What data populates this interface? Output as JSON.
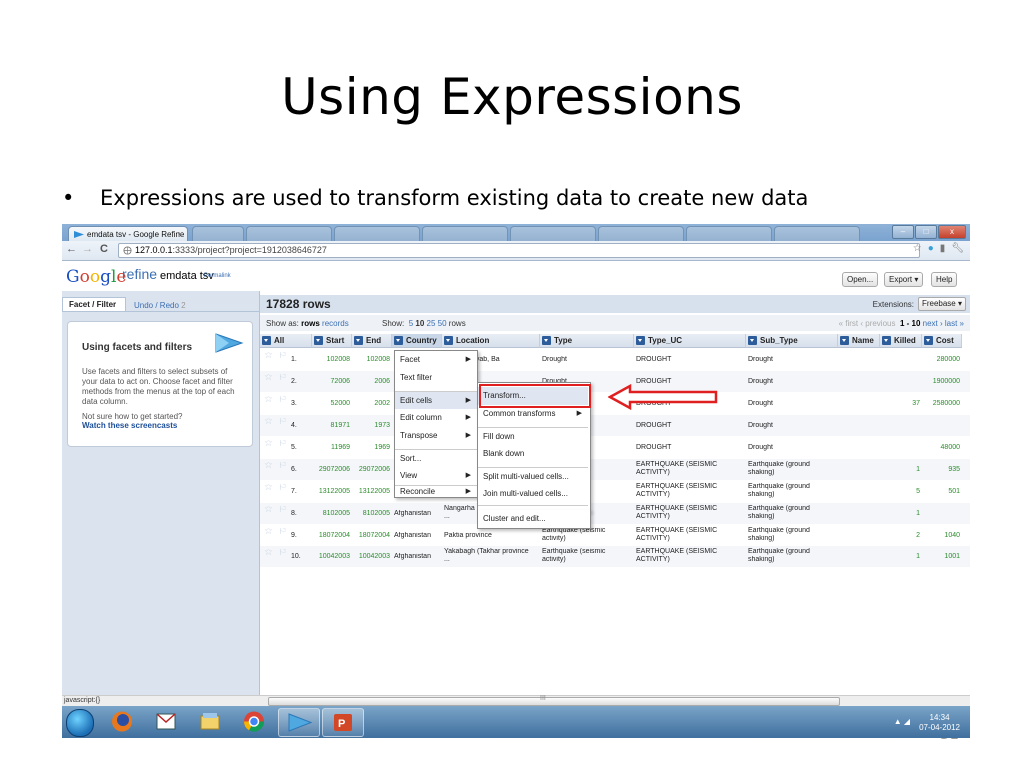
{
  "slide": {
    "title": "Using Expressions",
    "bullet_marker": "•",
    "bullet": "Expressions are used to transform existing data to create new data",
    "slide_number": "31"
  },
  "browser": {
    "tab_title": "emdata tsv - Google Refine",
    "tab_close": "×",
    "url_host": "127.0.0.1",
    "url_rest": ":3333/project?project=1912038646727",
    "nav_back": "←",
    "nav_forward": "→",
    "nav_reload": "C"
  },
  "app": {
    "logo_letters": [
      "G",
      "o",
      "o",
      "g",
      "l",
      "e"
    ],
    "product": "refine",
    "project_name": "emdata tsv",
    "permalink": "Permalink",
    "buttons": [
      "Open...",
      "Export ▾",
      "Help"
    ]
  },
  "left_panel": {
    "tab_active": "Facet / Filter",
    "tab_other": "Undo / Redo",
    "tab_other_count": "2",
    "help_title": "Using facets and filters",
    "help_text": "Use facets and filters to select subsets of your data to act on. Choose facet and filter methods from the menus at the top of each data column.",
    "help_question": "Not sure how to get started?",
    "help_link": "Watch these screencasts"
  },
  "data_panel": {
    "row_count": "17828 rows",
    "extensions_label": "Extensions:",
    "extensions_button": "Freebase ▾",
    "show_as_label": "Show as:",
    "show_as_rows": "rows",
    "show_as_records": "records",
    "show_label": "Show:",
    "show_options": [
      "5",
      "10",
      "25",
      "50"
    ],
    "show_unit": "rows",
    "pager_prev": "« first ‹ previous",
    "pager_range": "1 - 10",
    "pager_next": "next › last »"
  },
  "columns": [
    "All",
    "Start",
    "End",
    "Country",
    "Location",
    "Type",
    "Type_UC",
    "Sub_Type",
    "Name",
    "Killed",
    "Cost"
  ],
  "rows": [
    {
      "n": "1.",
      "start": "102008",
      "end": "102008",
      "country": "",
      "loc": "Balkh, Faryab, Ba",
      "type": "Drought",
      "type2": "",
      "uc": "DROUGHT",
      "uc2": "",
      "sub": "Drought",
      "sub2": "",
      "name": "",
      "killed": "",
      "cost": "280000"
    },
    {
      "n": "2.",
      "start": "72006",
      "end": "2006",
      "country": "",
      "loc": "",
      "type": "Drought",
      "type2": "",
      "uc": "DROUGHT",
      "uc2": "",
      "sub": "Drought",
      "sub2": "",
      "name": "",
      "killed": "",
      "cost": "1900000"
    },
    {
      "n": "3.",
      "start": "52000",
      "end": "2002",
      "country": "",
      "loc": "",
      "type": "",
      "type2": "",
      "uc": "DROUGHT",
      "uc2": "",
      "sub": "Drought",
      "sub2": "",
      "name": "",
      "killed": "37",
      "cost": "2580000"
    },
    {
      "n": "4.",
      "start": "81971",
      "end": "1973",
      "country": "",
      "loc": "",
      "type": "",
      "type2": "",
      "uc": "DROUGHT",
      "uc2": "",
      "sub": "Drought",
      "sub2": "",
      "name": "",
      "killed": "",
      "cost": ""
    },
    {
      "n": "5.",
      "start": "11969",
      "end": "1969",
      "country": "",
      "loc": "",
      "type": "",
      "type2": "",
      "uc": "DROUGHT",
      "uc2": "",
      "sub": "Drought",
      "sub2": "",
      "name": "",
      "killed": "",
      "cost": "48000"
    },
    {
      "n": "6.",
      "start": "29072006",
      "end": "29072006",
      "country": "",
      "loc": "",
      "type": "ismic",
      "type2": "",
      "uc": "EARTHQUAKE (SEISMIC",
      "uc2": "ACTIVITY)",
      "sub": "Earthquake (ground",
      "sub2": "shaking)",
      "name": "",
      "killed": "1",
      "cost": "935"
    },
    {
      "n": "7.",
      "start": "13122005",
      "end": "13122005",
      "country": "",
      "loc": "",
      "type": "ismic",
      "type2": "",
      "uc": "EARTHQUAKE (SEISMIC",
      "uc2": "ACTIVITY)",
      "sub": "Earthquake (ground",
      "sub2": "shaking)",
      "name": "",
      "killed": "5",
      "cost": "501"
    },
    {
      "n": "8.",
      "start": "8102005",
      "end": "8102005",
      "country": "Afghanistan",
      "loc": "Nangarha",
      "loc2": "...",
      "type": "ismic",
      "type2": "",
      "uc": "EARTHQUAKE (SEISMIC",
      "uc2": "ACTIVITY)",
      "sub": "Earthquake (ground",
      "sub2": "shaking)",
      "name": "",
      "killed": "1",
      "cost": ""
    },
    {
      "n": "9.",
      "start": "18072004",
      "end": "18072004",
      "country": "Afghanistan",
      "loc": "Paktia province",
      "type": "Earthquake (seismic",
      "type2": "activity)",
      "uc": "EARTHQUAKE (SEISMIC",
      "uc2": "ACTIVITY)",
      "sub": "Earthquake (ground",
      "sub2": "shaking)",
      "name": "",
      "killed": "2",
      "cost": "1040"
    },
    {
      "n": "10.",
      "start": "10042003",
      "end": "10042003",
      "country": "Afghanistan",
      "loc": "Yakabagh (Takhar province",
      "loc2": "...",
      "type": "Earthquake (seismic",
      "type2": "activity)",
      "uc": "EARTHQUAKE (SEISMIC",
      "uc2": "ACTIVITY)",
      "sub": "Earthquake (ground",
      "sub2": "shaking)",
      "name": "",
      "killed": "1",
      "cost": "1001"
    }
  ],
  "column_menu": {
    "items": [
      "Facet",
      "Text filter",
      "Edit cells",
      "Edit column",
      "Transpose",
      "Sort...",
      "View",
      "Reconcile"
    ]
  },
  "submenu": {
    "items": [
      "Transform...",
      "Common transforms",
      "Fill down",
      "Blank down",
      "Split multi-valued cells...",
      "Join multi-valued cells...",
      "Cluster and edit..."
    ]
  },
  "status": {
    "statusbar_text": "javascript:{}",
    "scroll_grip": "III",
    "clock_time": "14:34",
    "clock_date": "07-04-2012"
  },
  "colors": {
    "highlight_box": "#e02020",
    "link": "#3b6fb3",
    "number": "#2a8c2a"
  },
  "icons": [
    "star-icon",
    "flag-icon",
    "dropdown-icon",
    "globe-icon",
    "bookmark-star-icon",
    "wrench-icon",
    "start-orb-icon"
  ]
}
